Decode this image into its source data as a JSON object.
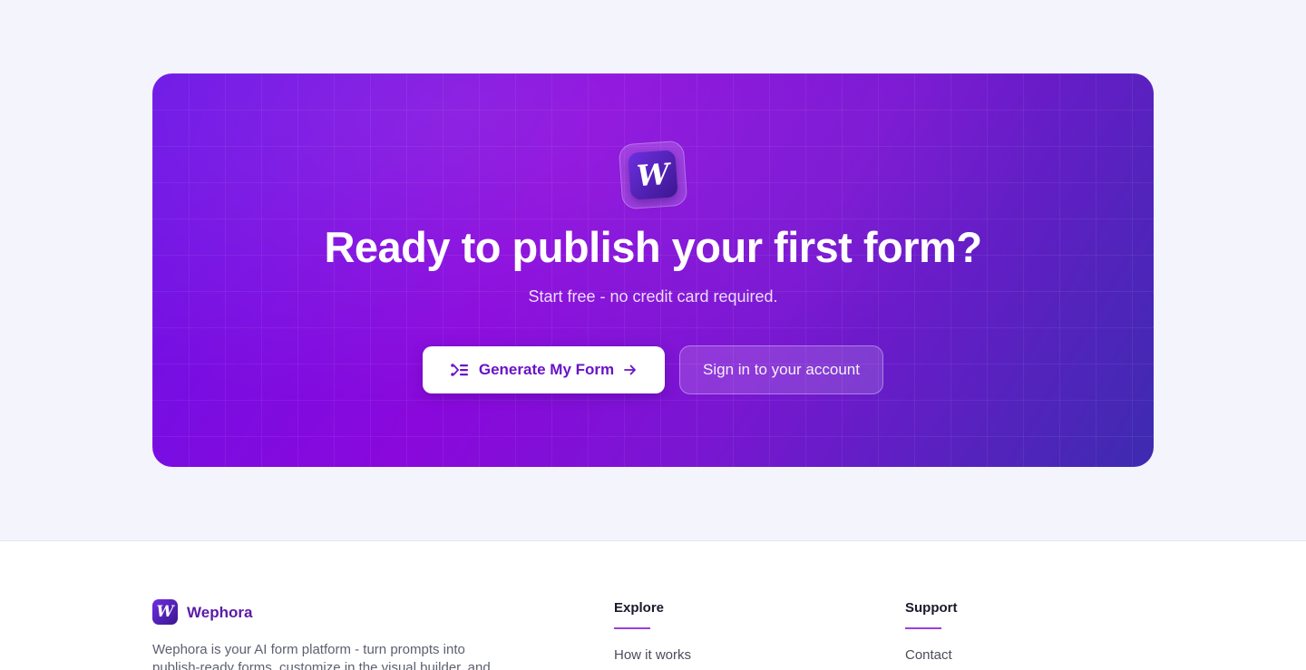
{
  "colors": {
    "page_background": "#f4f4fd",
    "cta_gradient_start": "#6a12e6",
    "cta_gradient_mid": "#8a08dc",
    "cta_gradient_end": "#3d2bb0",
    "primary_button_text": "#6a13c8",
    "brand": "#5b1aa8",
    "accent_underline": "#9b3fe0"
  },
  "cta": {
    "logo_letter": "W",
    "title": "Ready to publish your first form?",
    "subtitle": "Start free - no credit card required.",
    "primary_button": {
      "label": "Generate My Form",
      "leading_icon": "flow-icon",
      "trailing_icon": "arrow-right-icon"
    },
    "secondary_button": {
      "label": "Sign in to your account"
    }
  },
  "footer": {
    "logo_letter": "W",
    "brand_name": "Wephora",
    "description": "Wephora is your AI form platform - turn prompts into publish-ready forms, customize in the visual builder, and",
    "columns": [
      {
        "title": "Explore",
        "links": [
          "How it works"
        ]
      },
      {
        "title": "Support",
        "links": [
          "Contact"
        ]
      }
    ]
  }
}
